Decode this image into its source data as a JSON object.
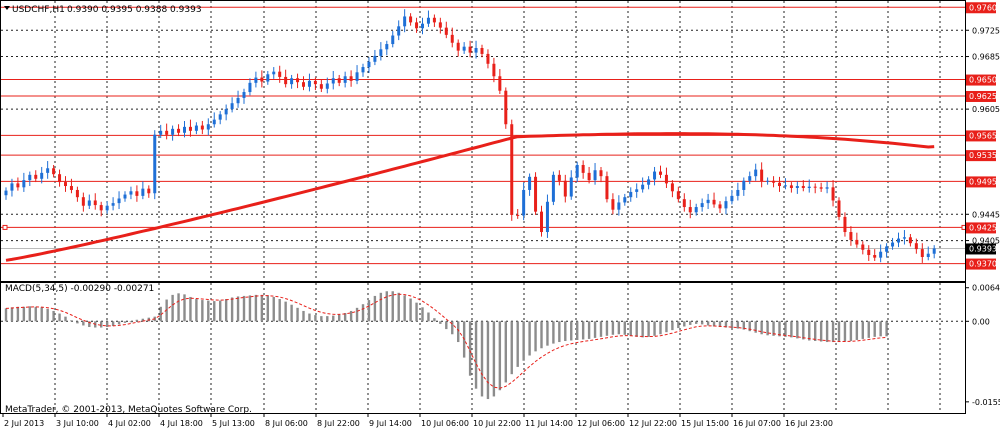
{
  "chart_header": {
    "symbol_text": "USDCHF,H1",
    "ohlc_text": "0.9390 0.9395 0.9388 0.9393"
  },
  "indicator": {
    "label": "MACD(5,34,5) -0.00290 -0.00271",
    "axis_labels": [
      "0.00648",
      "0.00",
      "-0.01554"
    ]
  },
  "copyright": "MetaTrader, © 2001-2013, MetaQuotes Software Corp.",
  "price_axis_labels": [
    "0.9725",
    "0.9685",
    "0.9605",
    "0.9445",
    "0.9405"
  ],
  "time_axis_labels": [
    "2 Jul 2013",
    "3 Jul 10:00",
    "4 Jul 02:00",
    "4 Jul 18:00",
    "5 Jul 13:00",
    "8 Jul 06:00",
    "8 Jul 22:00",
    "9 Jul 14:00",
    "10 Jul 06:00",
    "10 Jul 22:00",
    "11 Jul 14:00",
    "12 Jul 06:00",
    "12 Jul 22:00",
    "15 Jul 15:00",
    "16 Jul 07:00",
    "16 Jul 23:00"
  ],
  "horizontal_levels": [
    "0.9760",
    "0.9650",
    "0.9625",
    "0.9565",
    "0.9535",
    "0.9495",
    "0.9425",
    "0.9370"
  ],
  "current_price": "0.9393",
  "colors": {
    "up_candle": "#1e6fd6",
    "down_candle": "#e8201a",
    "level_line": "#e8201a",
    "moving_average": "#e8201a",
    "grid": "#222222",
    "macd_histogram": "#8c8c8c",
    "macd_signal": "#e8201a",
    "price_tag_bg": "#e8201a",
    "current_price_bg": "#000000"
  },
  "chart_data": {
    "type": "candlestick",
    "series": [
      {
        "name": "USDCHF,H1",
        "close": [
          0.9481,
          0.9492,
          0.9486,
          0.9497,
          0.9505,
          0.9499,
          0.9508,
          0.9515,
          0.9506,
          0.9494,
          0.9488,
          0.9482,
          0.9471,
          0.9458,
          0.9466,
          0.9459,
          0.9451,
          0.9458,
          0.9462,
          0.9469,
          0.9475,
          0.948,
          0.9473,
          0.9484,
          0.9477,
          0.9566,
          0.9572,
          0.9566,
          0.9575,
          0.9569,
          0.9578,
          0.9572,
          0.958,
          0.9574,
          0.9582,
          0.9589,
          0.9597,
          0.9605,
          0.9614,
          0.9622,
          0.9631,
          0.9645,
          0.9653,
          0.9647,
          0.9658,
          0.9662,
          0.9654,
          0.9643,
          0.9652,
          0.9646,
          0.9639,
          0.9648,
          0.9643,
          0.9636,
          0.9644,
          0.9652,
          0.9645,
          0.9655,
          0.9648,
          0.9661,
          0.9669,
          0.9677,
          0.9686,
          0.9696,
          0.9704,
          0.9717,
          0.9731,
          0.9746,
          0.9737,
          0.9728,
          0.9735,
          0.9744,
          0.9737,
          0.9729,
          0.9718,
          0.9706,
          0.9694,
          0.97,
          0.9691,
          0.9698,
          0.9689,
          0.9674,
          0.9655,
          0.9633,
          0.9582,
          0.9444,
          0.9443,
          0.9482,
          0.9502,
          0.9449,
          0.9418,
          0.9464,
          0.9505,
          0.9496,
          0.9472,
          0.9501,
          0.952,
          0.9508,
          0.9497,
          0.9512,
          0.9503,
          0.9468,
          0.9452,
          0.9463,
          0.9471,
          0.9479,
          0.9483,
          0.949,
          0.9498,
          0.951,
          0.9505,
          0.9492,
          0.948,
          0.9468,
          0.9456,
          0.9448,
          0.9456,
          0.9462,
          0.9467,
          0.946,
          0.9454,
          0.9465,
          0.9473,
          0.9482,
          0.9496,
          0.9503,
          0.9513,
          0.9495,
          0.9496,
          0.9493,
          0.9488,
          0.9489,
          0.9485,
          0.9488,
          0.9485,
          0.9487,
          0.9486,
          0.9484,
          0.9486,
          0.9466,
          0.9441,
          0.9418,
          0.9406,
          0.9399,
          0.9391,
          0.9383,
          0.9379,
          0.9388,
          0.9396,
          0.9402,
          0.9408,
          0.941,
          0.9401,
          0.9392,
          0.938,
          0.9385,
          0.9393
        ]
      },
      {
        "name": "MACD(5,34,5)",
        "values": [
          0.0025,
          0.0027,
          0.0028,
          0.0028,
          0.0029,
          0.0028,
          0.0027,
          0.0024,
          0.002,
          0.0015,
          0.0009,
          0.0002,
          -0.0004,
          -0.0008,
          -0.0011,
          -0.0012,
          -0.0012,
          -0.0011,
          -0.0009,
          -0.0006,
          -0.0003,
          0.0,
          0.0003,
          0.0005,
          0.0007,
          0.0009,
          0.0028,
          0.0042,
          0.0051,
          0.0054,
          0.0052,
          0.0047,
          0.0043,
          0.0041,
          0.004,
          0.0039,
          0.004,
          0.0043,
          0.0046,
          0.0048,
          0.0049,
          0.005,
          0.0051,
          0.0051,
          0.005,
          0.0047,
          0.0043,
          0.0038,
          0.0032,
          0.0026,
          0.002,
          0.0015,
          0.0012,
          0.001,
          0.001,
          0.0011,
          0.0013,
          0.0016,
          0.002,
          0.0026,
          0.0033,
          0.0041,
          0.0049,
          0.0055,
          0.0058,
          0.0058,
          0.0055,
          0.005,
          0.0044,
          0.0036,
          0.0027,
          0.0017,
          0.0006,
          -0.0005,
          -0.0015,
          -0.0025,
          -0.004,
          -0.007,
          -0.0105,
          -0.013,
          -0.0145,
          -0.015,
          -0.0145,
          -0.0133,
          -0.0118,
          -0.0102,
          -0.0088,
          -0.0076,
          -0.0066,
          -0.0058,
          -0.0052,
          -0.0047,
          -0.0043,
          -0.004,
          -0.0038,
          -0.0037,
          -0.0036,
          -0.0035,
          -0.0034,
          -0.0032,
          -0.003,
          -0.0028,
          -0.0026,
          -0.0025,
          -0.0026,
          -0.0028,
          -0.003,
          -0.0031,
          -0.003,
          -0.0028,
          -0.0025,
          -0.0021,
          -0.0017,
          -0.0013,
          -0.001,
          -0.0007,
          -0.0005,
          -0.0006,
          -0.0008,
          -0.001,
          -0.0011,
          -0.0012,
          -0.0013,
          -0.0014,
          -0.0016,
          -0.0019,
          -0.0022,
          -0.0025,
          -0.0027,
          -0.0028,
          -0.0029,
          -0.003,
          -0.0031,
          -0.0033,
          -0.0035,
          -0.0037,
          -0.0038,
          -0.0039,
          -0.004,
          -0.004,
          -0.004,
          -0.0039,
          -0.0038,
          -0.0036,
          -0.0034,
          -0.0032,
          -0.003,
          -0.0029,
          -0.0029
        ]
      }
    ],
    "moving_average": {
      "start": 0.9375,
      "end": 0.9548
    },
    "ylim": [
      0.9345,
      0.9768
    ],
    "macd_ylim": [
      -0.0175,
      0.0072
    ],
    "grid": true
  }
}
